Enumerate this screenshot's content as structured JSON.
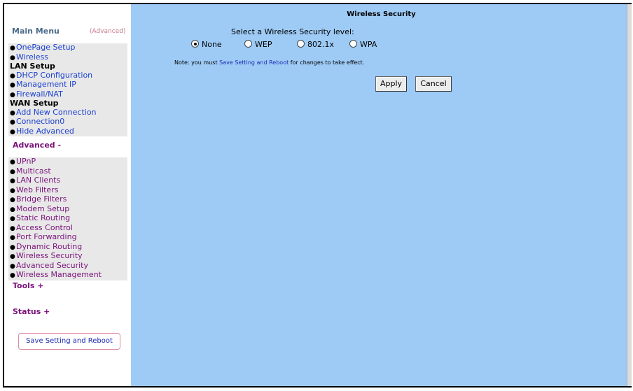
{
  "sidebar": {
    "main_menu_label": "Main Menu",
    "advanced_label": "(Advanced)",
    "main_items": [
      {
        "label": "OnePage Setup"
      },
      {
        "label": "Wireless"
      }
    ],
    "lan_header": "LAN Setup",
    "lan_items": [
      {
        "label": "DHCP Configuration"
      },
      {
        "label": "Management IP"
      },
      {
        "label": "Firewall/NAT"
      }
    ],
    "wan_header": "WAN Setup",
    "wan_items": [
      {
        "label": "Add New Connection"
      },
      {
        "label": "Connection0"
      },
      {
        "label": "Hide Advanced"
      }
    ],
    "advanced_section": "Advanced -",
    "advanced_items": [
      {
        "label": "UPnP"
      },
      {
        "label": "Multicast"
      },
      {
        "label": "LAN Clients"
      },
      {
        "label": "Web Filters"
      },
      {
        "label": "Bridge Filters"
      },
      {
        "label": "Modem Setup"
      },
      {
        "label": "Static Routing"
      },
      {
        "label": "Access Control"
      },
      {
        "label": "Port Forwarding"
      },
      {
        "label": "Dynamic Routing"
      },
      {
        "label": "Wireless Security"
      },
      {
        "label": "Advanced Security"
      },
      {
        "label": "Wireless Management"
      }
    ],
    "tools_section": "Tools +",
    "status_section": "Status +",
    "save_button": "Save Setting and Reboot"
  },
  "main": {
    "title": "Wireless Security",
    "select_label": "Select a Wireless Security level:",
    "options": [
      {
        "label": "None",
        "selected": true
      },
      {
        "label": "WEP",
        "selected": false
      },
      {
        "label": "802.1x",
        "selected": false
      },
      {
        "label": "WPA",
        "selected": false
      }
    ],
    "note_prefix": "Note: you must ",
    "note_link": "Save Setting and Reboot",
    "note_suffix": " for changes to take effect.",
    "apply_button": "Apply",
    "cancel_button": "Cancel"
  },
  "colors": {
    "content_bg": "#9ecbf6",
    "menu_bg": "#e8e8e8",
    "link_blue": "#1a3fd0",
    "link_purple": "#7a127a"
  }
}
